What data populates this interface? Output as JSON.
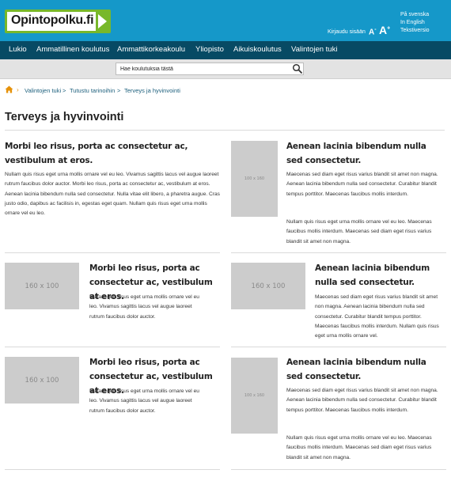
{
  "header": {
    "logo_text": "Opintopolku.fi",
    "login": "Kirjaudu sisään",
    "font_small": "A",
    "font_large": "A",
    "languages": [
      "På svenska",
      "In English",
      "Tekstiversio"
    ]
  },
  "nav": {
    "items": [
      "Lukio",
      "Ammatillinen koulutus",
      "Ammattikorkeakoulu",
      "Yliopisto",
      "Aikuiskoulutus",
      "Valintojen tuki"
    ]
  },
  "search": {
    "placeholder": "Hae koulutuksia tästä"
  },
  "breadcrumb": [
    "Valintojen tuki",
    "Tutustu tarinoihin",
    "Terveys ja hyvinvointi"
  ],
  "page_title": "Terveys ja hyvinvointi",
  "articles": [
    {
      "title": "Morbi leo risus, porta ac consectetur ac, vestibulum at eros.",
      "text": "Nullam quis risus eget urna mollis ornare vel eu leo. Vivamus sagittis lacus vel augue laoreet rutrum faucibus dolor auctor. Morbi leo risus, porta ac consectetur ac, vestibulum at eros. Aenean lacinia bibendum nulla sed consectetur. Nulla vitae elit libero, a pharetra augue. Cras justo odio, dapibus ac facilisis in, egestas eget quam. Nullam quis risus eget urna mollis ornare vel eu leo."
    },
    {
      "image": "100 x 160",
      "title": "Aenean lacinia bibendum nulla sed consectetur.",
      "text": "Maecenas sed diam eget risus varius blandit sit amet non magna. Aenean lacinia bibendum nulla sed consectetur. Curabitur blandit tempus porttitor. Maecenas faucibus mollis interdum.",
      "text2": "Nullam quis risus eget urna mollis ornare vel eu leo. Maecenas faucibus mollis interdum. Maecenas sed diam eget risus varius blandit sit amet non magna."
    },
    {
      "image": "160 x 100",
      "title": "Morbi leo risus, porta ac consectetur ac, vestibulum at eros.",
      "text": "Nullam quis risus eget urna mollis ornare vel eu leo. Vivamus sagittis lacus vel augue laoreet rutrum faucibus dolor auctor."
    },
    {
      "image": "160 x 100",
      "title": "Aenean lacinia bibendum nulla sed consectetur.",
      "text": "Maecenas sed diam eget risus varius blandit sit amet non magna. Aenean lacinia bibendum nulla sed consectetur. Curabitur blandit tempus porttitor. Maecenas faucibus mollis interdum. Nullam quis risus eget urna mollis ornare vel."
    },
    {
      "image": "160 x 100",
      "title": "Morbi leo risus, porta ac consectetur ac, vestibulum at eros.",
      "text": "Nullam quis risus eget urna mollis ornare vel eu leo. Vivamus sagittis lacus vel augue laoreet rutrum faucibus dolor auctor."
    },
    {
      "image": "100 x 160",
      "title": "Aenean lacinia bibendum nulla sed consectetur.",
      "text": "Maecenas sed diam eget risus varius blandit sit amet non magna. Aenean lacinia bibendum nulla sed consectetur. Curabitur blandit tempus porttitor. Maecenas faucibus mollis interdum.",
      "text2": "Nullam quis risus eget urna mollis ornare vel eu leo. Maecenas faucibus mollis interdum. Maecenas sed diam eget risus varius blandit sit amet non magna."
    }
  ],
  "colors": {
    "header": "#1598c9",
    "nav": "#074a64",
    "logo_green": "#78b82a",
    "link": "#1c5f7c",
    "breadcrumb_separator": "#e6920a"
  },
  "icons": [
    "home-icon",
    "search-icon",
    "chevron-right-icon"
  ]
}
